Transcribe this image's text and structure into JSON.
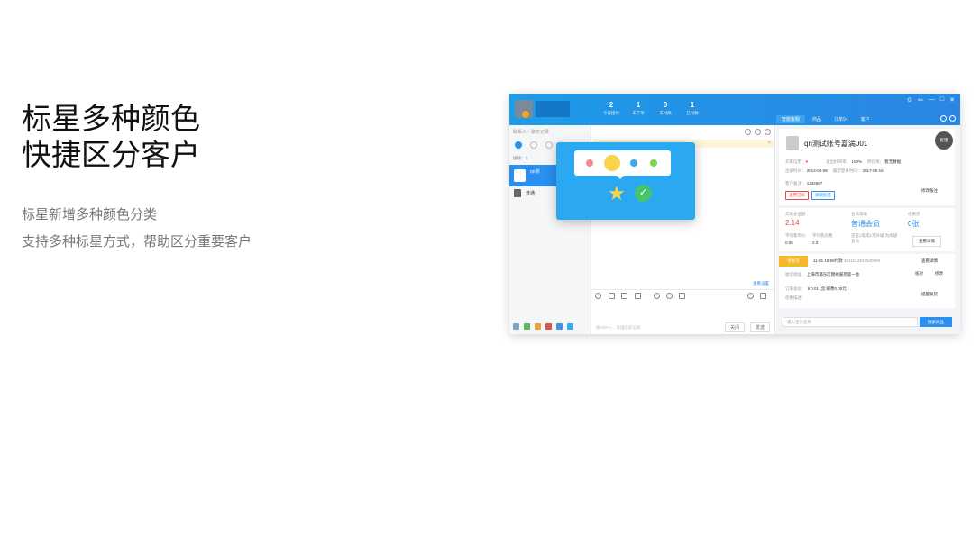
{
  "promo": {
    "title_line1": "标星多种颜色",
    "title_line2": "快捷区分客户",
    "desc_line1": "标星新增多种颜色分类",
    "desc_line2": "支持多种标星方式，帮助区分重要客户"
  },
  "header": {
    "stats": [
      {
        "num": "2",
        "label": "今日接待"
      },
      {
        "num": "1",
        "label": "未下单"
      },
      {
        "num": "0",
        "label": "未付款"
      },
      {
        "num": "1",
        "label": "已付款"
      }
    ],
    "window_controls": [
      "⊙",
      "⇦",
      "—",
      "□",
      "✕"
    ],
    "right_tabs": [
      "智能客服",
      "商品",
      "订单9+",
      "客户"
    ]
  },
  "left_panel": {
    "search_placeholder": "联系人・聊天记录",
    "group_label": "接待：2",
    "contacts": [
      {
        "name": "qn测"
      },
      {
        "name": "普通"
      }
    ]
  },
  "center": {
    "settings_link": "查看设置",
    "input_hint": "按Ctrl+↵，发送历史记录",
    "close_button": "关闭",
    "send_button": "发送"
  },
  "customer": {
    "name": "qn测试账号嘉満001",
    "feedback_badge": "反馈",
    "rows": {
      "r1": {
        "k1": "买家信用：",
        "k2": "发出好评率：",
        "v2": "100%",
        "k3": "所在地：",
        "v3": "暂无数据"
      },
      "r2": {
        "k1": "注册时间：",
        "v1": "2014-08-08",
        "k2": "最近登录时间：",
        "v2": "2017-05-18"
      },
      "r3": {
        "k1": "客户备注：",
        "v1": "1234567"
      }
    },
    "tags": [
      "通用已标",
      "测试标签"
    ],
    "edit_note_button": "修改备注"
  },
  "stats_card": {
    "total_label": "交易总金额",
    "total_value": "2.14",
    "level_label": "会员等级",
    "level_value": "普通会员",
    "coupon_label": "优惠券",
    "coupon_value": "0张",
    "avg_order_label": "平均客单价",
    "avg_order_value": "0.05",
    "avg_buy_label": "平均购买数",
    "avg_buy_value": "2.3",
    "upgrade_text": "还差1笔或1元升级 为高级会员",
    "detail_button": "查看详情"
  },
  "order_card": {
    "badge": "待发货",
    "datetime": "11-01 19:59付款",
    "order_no": "2541012537520069",
    "detail_button": "查看详情",
    "address_label": "收货地址：",
    "address_value": "上海市浦东区锦绣嘉苑第一会",
    "edit_button": "核对",
    "modify_button": "修改",
    "price_label": "订单总价：",
    "price_value": "￥0.01 (含:邮费0.00元)",
    "discount_label": "优惠描述：",
    "remind_button": "提醒发货"
  },
  "product_search": {
    "placeholder": "输入宝贝名称",
    "button": "搜索商品"
  },
  "popup": {
    "colors": [
      "#f48a8a",
      "#f9d34c",
      "#3aa7f0",
      "#7dd44f"
    ],
    "star_icon": "★",
    "check_icon": "✓"
  }
}
